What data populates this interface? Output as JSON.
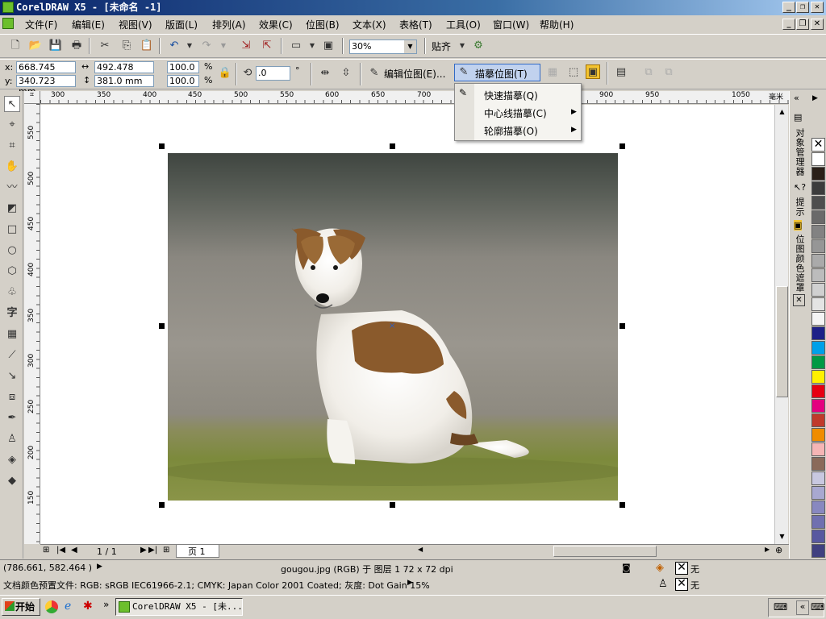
{
  "window": {
    "title": "CorelDRAW X5 - [未命名 -1]"
  },
  "menu": [
    "文件(F)",
    "编辑(E)",
    "视图(V)",
    "版面(L)",
    "排列(A)",
    "效果(C)",
    "位图(B)",
    "文本(X)",
    "表格(T)",
    "工具(O)",
    "窗口(W)",
    "帮助(H)"
  ],
  "toolbar": {
    "zoom": "30%",
    "snap_label": "贴齐"
  },
  "propbar": {
    "x_label": "x:",
    "x": "668.745 mm",
    "y_label": "y:",
    "y": "340.723 mm",
    "w": "492.478 mm",
    "h": "381.0 mm",
    "scale_x": "100.0",
    "scale_y": "100.0",
    "pct": "%",
    "angle": ".0",
    "deg": "°",
    "edit_bitmap": "编辑位图(E)...",
    "trace_bitmap": "描摹位图(T)"
  },
  "trace_menu": [
    {
      "label": "快速描摹(Q)",
      "submenu": false
    },
    {
      "label": "中心线描摹(C)",
      "submenu": true
    },
    {
      "label": "轮廓描摹(O)",
      "submenu": true
    }
  ],
  "ruler_top": [
    "300",
    "350",
    "400",
    "450",
    "500",
    "550",
    "600",
    "650",
    "700",
    "900",
    "950",
    "1050",
    "毫米"
  ],
  "ruler_left": [
    "550",
    "500",
    "450",
    "400",
    "350",
    "300",
    "250",
    "200",
    "150"
  ],
  "dockers": [
    "对象管理器",
    "提示",
    "位图颜色遮罩"
  ],
  "palette": [
    "#ffffff",
    "#2a1f18",
    "#3c3c3c",
    "#4e4e4e",
    "#6a6a6a",
    "#828282",
    "#969696",
    "#aaaaaa",
    "#bcbcbc",
    "#d0d0d0",
    "#e4e4e4",
    "#f4f4f4",
    "#1d2088",
    "#00a0e9",
    "#009944",
    "#fff100",
    "#e60012",
    "#e4007f",
    "#c0392b",
    "#f08c00",
    "#f5b5b5",
    "#8a6a5a",
    "#c8c8e0",
    "#a8a8d0",
    "#8888c0",
    "#7070b0",
    "#5858a0",
    "#404080"
  ],
  "page_nav": {
    "position": "1 / 1",
    "tab": "页 1"
  },
  "status": {
    "coords": "(786.661, 582.464 )",
    "info": "gougou.jpg (RGB) 于 图层 1 72 x 72 dpi",
    "profiles": "文档颜色预置文件: RGB: sRGB IEC61966-2.1; CMYK: Japan Color 2001 Coated; 灰度: Dot Gain 15%",
    "fill": "无",
    "outline": "无"
  },
  "taskbar": {
    "start": "开始",
    "task": "CorelDRAW X5 - [未..."
  }
}
